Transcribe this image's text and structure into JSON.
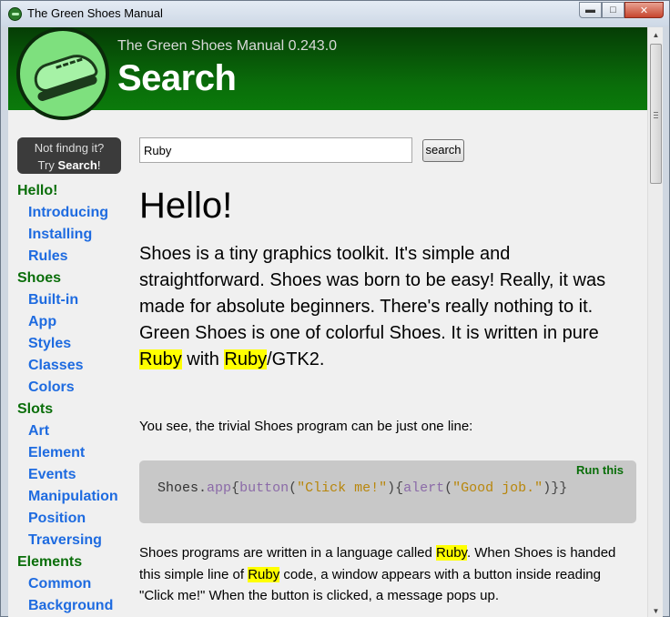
{
  "window": {
    "title": "The Green Shoes Manual",
    "buttons": {
      "minimize": "▬",
      "maximize": "□",
      "close": "✕"
    }
  },
  "header": {
    "subtitle": "The Green Shoes Manual 0.243.0",
    "title": "Search"
  },
  "sidebar": {
    "help_line1": "Not findng it?",
    "help_try": "Try",
    "help_search": "Search",
    "help_bang": "!",
    "nav": [
      {
        "label": "Hello!",
        "type": "section"
      },
      {
        "label": "Introducing",
        "type": "sub"
      },
      {
        "label": "Installing",
        "type": "sub"
      },
      {
        "label": "Rules",
        "type": "sub"
      },
      {
        "label": "Shoes",
        "type": "section"
      },
      {
        "label": "Built-in",
        "type": "sub"
      },
      {
        "label": "App",
        "type": "sub"
      },
      {
        "label": "Styles",
        "type": "sub"
      },
      {
        "label": "Classes",
        "type": "sub"
      },
      {
        "label": "Colors",
        "type": "sub"
      },
      {
        "label": "Slots",
        "type": "section"
      },
      {
        "label": "Art",
        "type": "sub"
      },
      {
        "label": "Element",
        "type": "sub"
      },
      {
        "label": "Events",
        "type": "sub"
      },
      {
        "label": "Manipulation",
        "type": "sub"
      },
      {
        "label": "Position",
        "type": "sub"
      },
      {
        "label": "Traversing",
        "type": "sub"
      },
      {
        "label": "Elements",
        "type": "section"
      },
      {
        "label": "Common",
        "type": "sub"
      },
      {
        "label": "Background",
        "type": "sub"
      }
    ]
  },
  "search": {
    "value": "Ruby",
    "button": "search"
  },
  "content": {
    "heading": "Hello!",
    "intro": {
      "p1": "Shoes is a tiny graphics toolkit. It's simple and straightforward. Shoes was born to be easy!  Really, it was made for absolute beginners. There's really nothing to it. Green Shoes is one of colorful Shoes. It is written in pure ",
      "hl1": "Ruby",
      "p2": "  with ",
      "hl2": "Ruby",
      "p3": "/GTK2."
    },
    "para2": "You see, the trivial Shoes program can be just one line:",
    "code": {
      "run_label": "Run this",
      "obj": "Shoes",
      "dot": ".",
      "m1": "app",
      "b1": "{",
      "m2": "button",
      "p1": "(",
      "s1": "\"Click me!\"",
      "p2": "){",
      "m3": "alert",
      "p3": "(",
      "s2": "\"Good job.\"",
      "p4": ")}}"
    },
    "para3": {
      "t1": "Shoes programs are written in a language called ",
      "hl1": "Ruby",
      "t2": ".  When Shoes is handed this simple line of ",
      "hl2": "Ruby",
      "t3": " code, a window appears with a button inside reading \"Click me!\"  When the button is clicked, a message pops up."
    }
  }
}
